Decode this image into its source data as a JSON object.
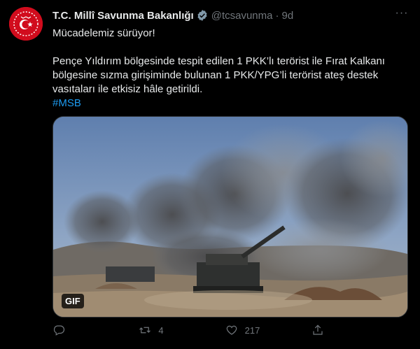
{
  "tweet": {
    "author_name": "T.C. Millî Savunma Bakanlığı",
    "handle": "@tcsavunma",
    "separator": "·",
    "time": "9d",
    "more_label": "···",
    "text_line1": "Mücadelemiz sürüyor!",
    "text_body": "Pençe Yıldırım bölgesinde tespit edilen 1 PKK’lı terörist ile Fırat Kalkanı bölgesine sızma girişiminde bulunan 1 PKK/YPG’li terörist ateş destek vasıtaları ile etkisiz hâle getirildi.",
    "hashtag": "#MSB",
    "media_badge": "GIF"
  },
  "actions": {
    "reply_count": "",
    "retweet_count": "4",
    "like_count": "217",
    "share_count": ""
  },
  "icons": [
    "government-seal-icon",
    "verified-badge-icon",
    "more-icon",
    "reply-icon",
    "retweet-icon",
    "like-icon",
    "share-icon"
  ],
  "colors": {
    "background": "#000000",
    "text": "#e7e9ea",
    "secondary": "#71767b",
    "link": "#1d9bf0",
    "verified": "#829aab",
    "avatar": "#d10c1d"
  }
}
